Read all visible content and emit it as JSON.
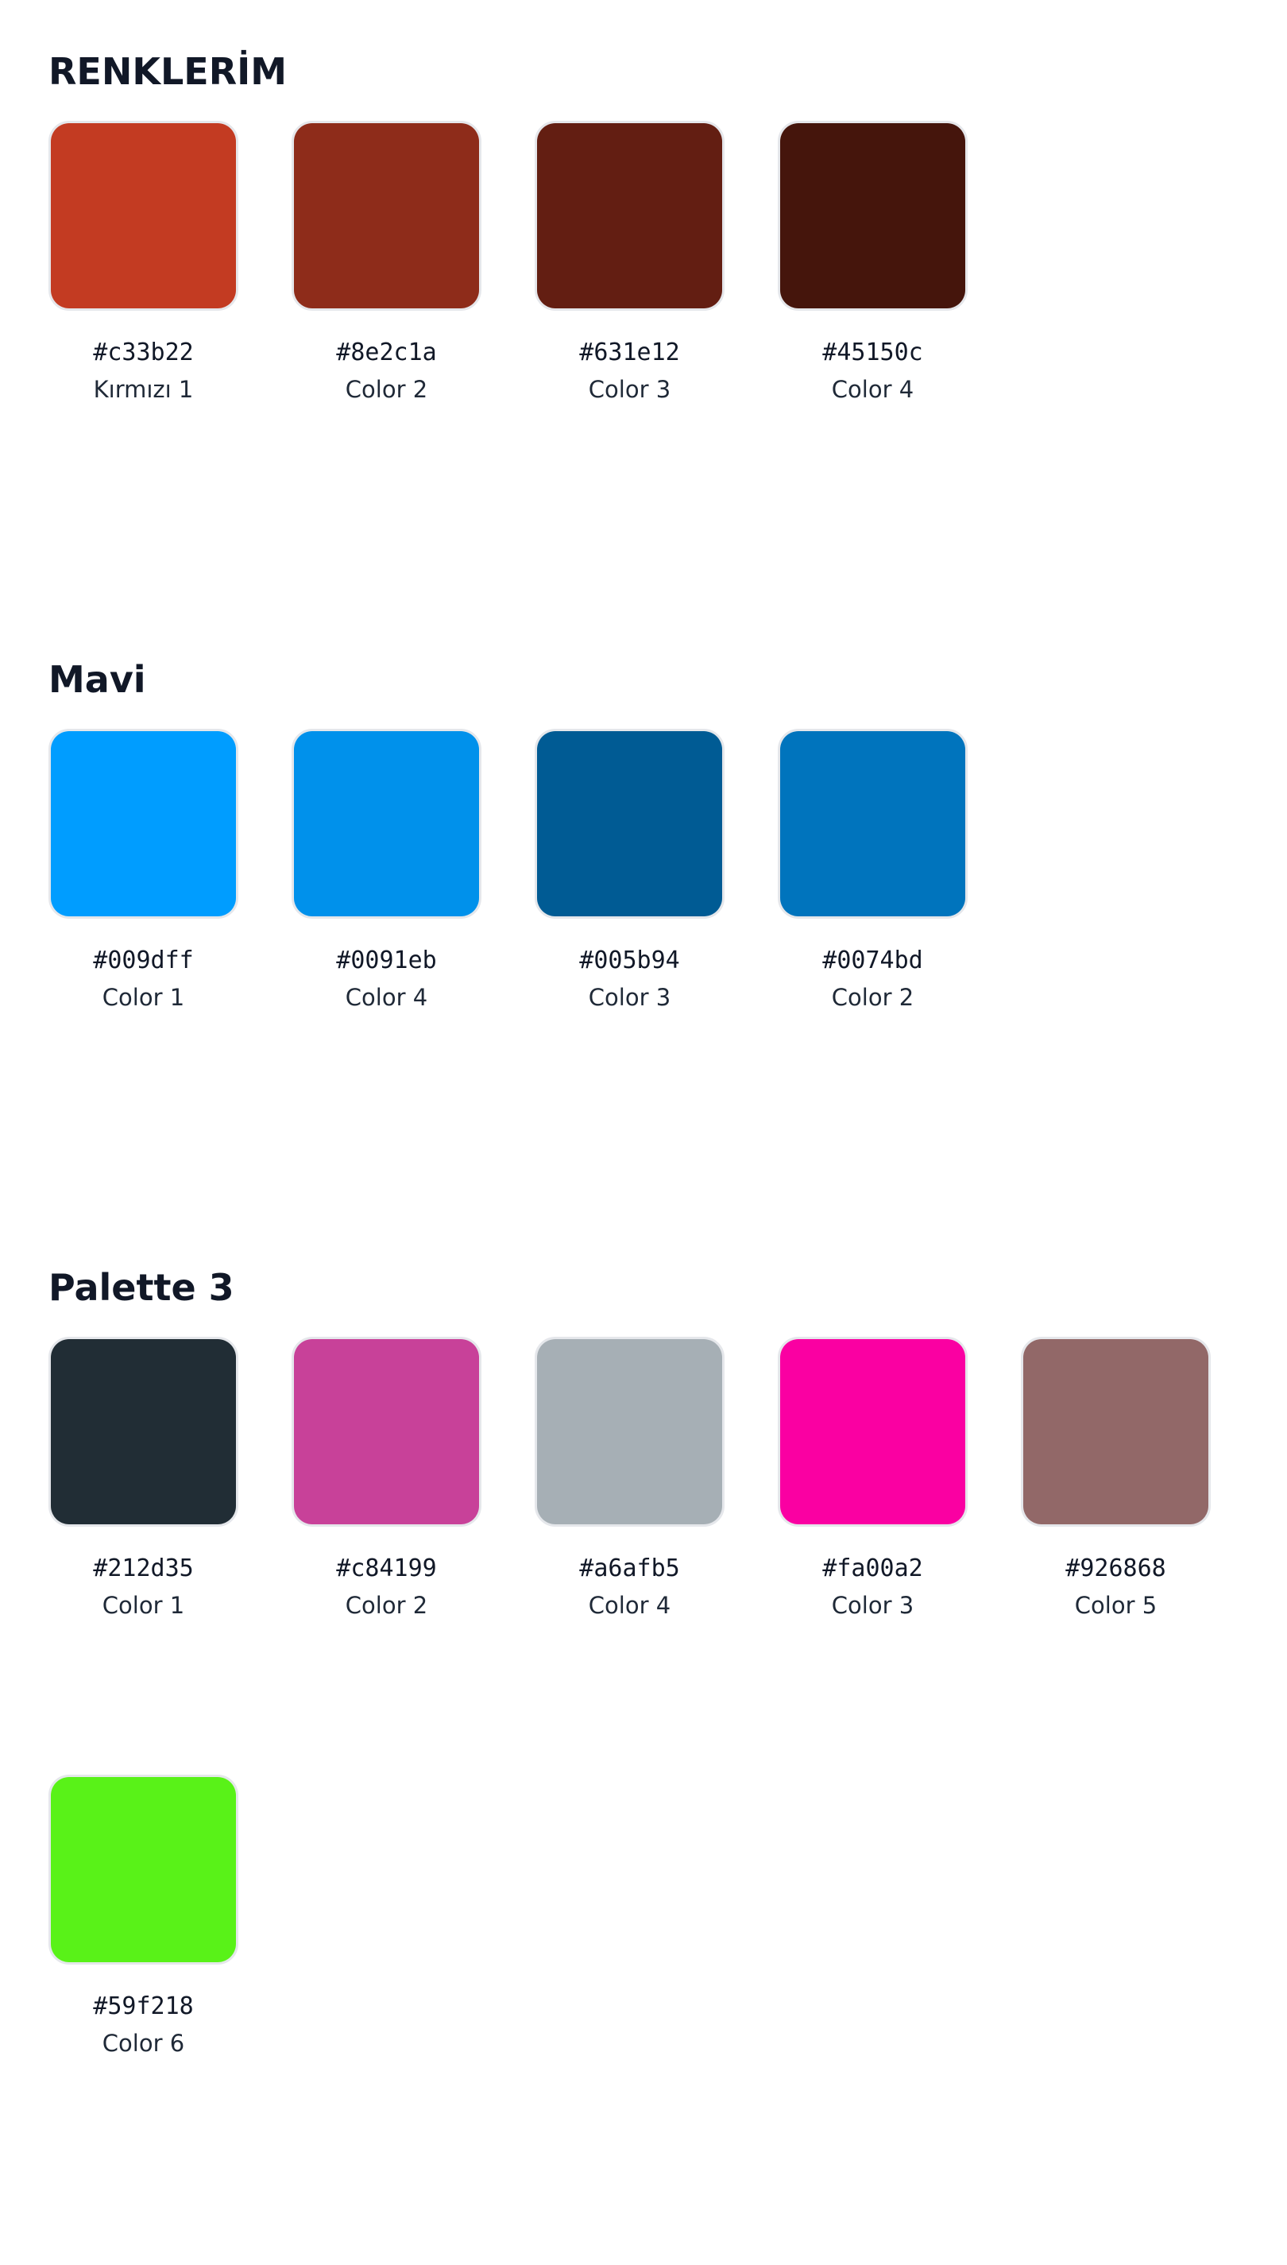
{
  "palettes": [
    {
      "title": "RENKLERİM",
      "colors": [
        {
          "hex": "#c33b22",
          "name": "Kırmızı 1"
        },
        {
          "hex": "#8e2c1a",
          "name": "Color 2"
        },
        {
          "hex": "#631e12",
          "name": "Color 3"
        },
        {
          "hex": "#45150c",
          "name": "Color 4"
        }
      ]
    },
    {
      "title": "Mavi",
      "colors": [
        {
          "hex": "#009dff",
          "name": "Color 1"
        },
        {
          "hex": "#0091eb",
          "name": "Color 4"
        },
        {
          "hex": "#005b94",
          "name": "Color 3"
        },
        {
          "hex": "#0074bd",
          "name": "Color 2"
        }
      ]
    },
    {
      "title": "Palette 3",
      "colors": [
        {
          "hex": "#212d35",
          "name": "Color 1"
        },
        {
          "hex": "#c84199",
          "name": "Color 2"
        },
        {
          "hex": "#a6afb5",
          "name": "Color 4"
        },
        {
          "hex": "#fa00a2",
          "name": "Color 3"
        },
        {
          "hex": "#926868",
          "name": "Color 5"
        },
        {
          "hex": "#59f218",
          "name": "Color 6"
        }
      ]
    }
  ]
}
